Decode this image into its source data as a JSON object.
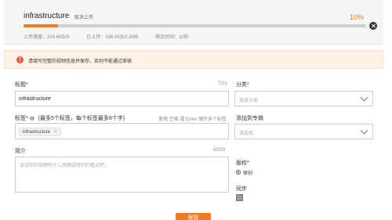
{
  "upload": {
    "file_name": "infrastructure",
    "cancel_label": "取消上传",
    "percent_label": "10%",
    "progress_fraction": 0.1,
    "speed": "上传速度：314.6KB/S",
    "uploaded": "已上传：336.0KB/3.2MB",
    "remaining": "剩余时间：10秒"
  },
  "warning": {
    "icon_text": "!",
    "text": "请填写完整的视频信息并保存，否则不能通过审核"
  },
  "form": {
    "title": {
      "label": "标题*",
      "counter": "7/21",
      "value": "infrastructure"
    },
    "category": {
      "label": "分类*",
      "placeholder": "选择分类"
    },
    "tags": {
      "label": "标签*",
      "help_icon": "?",
      "rule": "(最多5个标签，每个标签最多8个字)",
      "hint": "使用 空格 或 Enter 键开多个标签",
      "items": [
        {
          "label": "infrastructure",
          "remove": "×"
        }
      ]
    },
    "album": {
      "label": "添加到专辑",
      "placeholder": "请选择"
    },
    "intro": {
      "label": "简介",
      "counter": "0/200",
      "placeholder": "说说你的视频有什么亮眼或特别的看点吧..."
    },
    "copyright": {
      "label": "版权*",
      "option": "原创"
    },
    "sync": {
      "label": "同步"
    },
    "save_label": "保存"
  },
  "icons": {
    "close": "close-icon",
    "warning": "warning-icon",
    "dropdown": "chevron-down-icon",
    "help": "help-icon"
  },
  "colors": {
    "accent": "#f07c22",
    "warning_bg": "#fdf1e8",
    "warning_icon": "#e55a40"
  }
}
